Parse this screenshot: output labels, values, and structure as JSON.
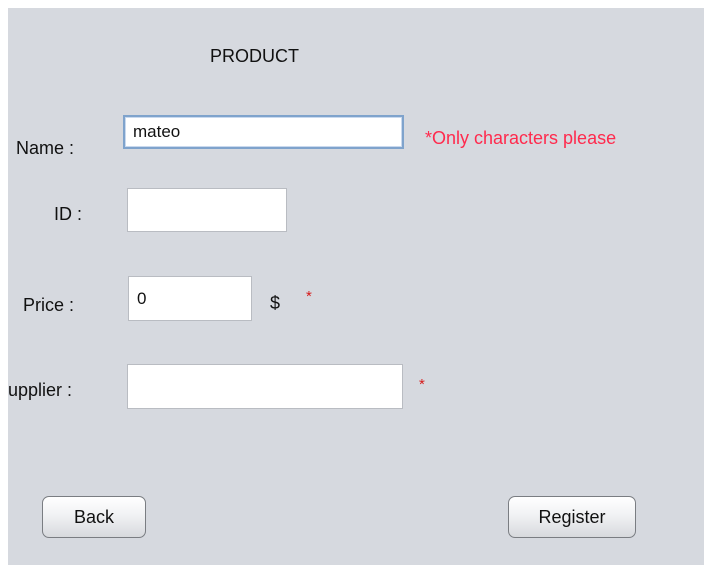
{
  "form": {
    "title": "PRODUCT",
    "name_label": "Name :",
    "name_value": "mateo",
    "name_error": "*Only characters please",
    "id_label": "ID :",
    "id_value": "",
    "price_label": "Price :",
    "price_value": "0",
    "price_currency": "$",
    "price_required": "*",
    "supplier_label": "upplier :",
    "supplier_value": "",
    "supplier_required": "*"
  },
  "buttons": {
    "back_label": "Back",
    "register_label": "Register"
  },
  "colors": {
    "background": "#d6d9df",
    "error": "#ff2a4d",
    "required": "#d61a1a"
  }
}
